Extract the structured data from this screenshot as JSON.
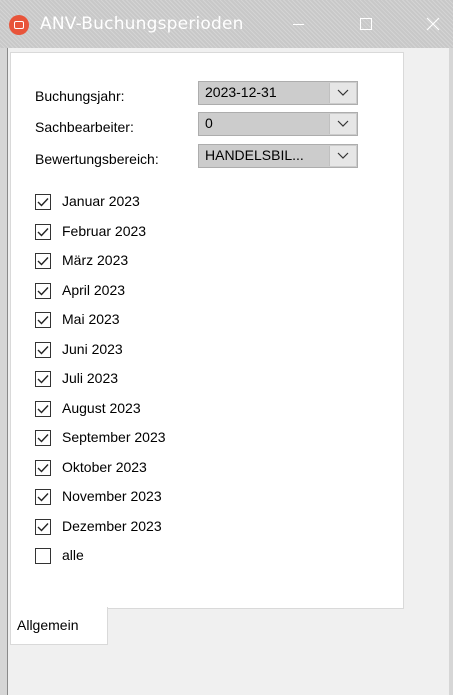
{
  "window": {
    "title": "ANV-Buchungsperioden"
  },
  "form": {
    "year_label": "Buchungsjahr:",
    "year_value": "2023-12-31",
    "clerk_label": "Sachbearbeiter:",
    "clerk_value": "0",
    "area_label": "Bewertungsbereich:",
    "area_value": "HANDELSBIL..."
  },
  "periods": [
    {
      "label": "Januar 2023",
      "checked": true
    },
    {
      "label": "Februar 2023",
      "checked": true
    },
    {
      "label": "März 2023",
      "checked": true
    },
    {
      "label": "April 2023",
      "checked": true
    },
    {
      "label": "Mai 2023",
      "checked": true
    },
    {
      "label": "Juni 2023",
      "checked": true
    },
    {
      "label": "Juli 2023",
      "checked": true
    },
    {
      "label": "August 2023",
      "checked": true
    },
    {
      "label": "September 2023",
      "checked": true
    },
    {
      "label": "Oktober 2023",
      "checked": true
    },
    {
      "label": "November 2023",
      "checked": true
    },
    {
      "label": "Dezember 2023",
      "checked": true
    },
    {
      "label": "alle",
      "checked": false
    }
  ],
  "tabs": [
    {
      "label": "Allgemein"
    }
  ],
  "icons": {
    "app": "app-icon",
    "dropdown": "chevron-down-icon",
    "check": "checkmark-icon"
  },
  "colors": {
    "accent": "#e8543a",
    "combo_bg": "#cccccc"
  }
}
